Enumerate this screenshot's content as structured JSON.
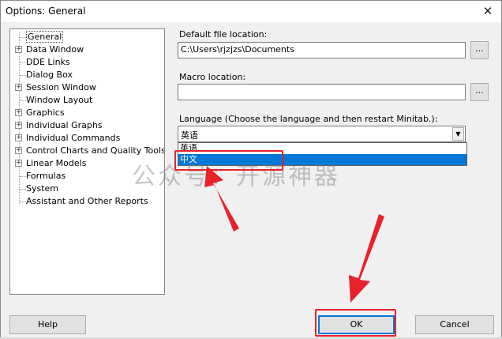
{
  "window": {
    "title": "Options: General",
    "close_glyph": "✕"
  },
  "tree": {
    "items": [
      {
        "label": "General",
        "expandable": false,
        "selected": true
      },
      {
        "label": "Data Window",
        "expandable": true
      },
      {
        "label": "DDE Links",
        "expandable": false
      },
      {
        "label": "Dialog Box",
        "expandable": false
      },
      {
        "label": "Session Window",
        "expandable": true
      },
      {
        "label": "Window Layout",
        "expandable": false
      },
      {
        "label": "Graphics",
        "expandable": true
      },
      {
        "label": "Individual Graphs",
        "expandable": true
      },
      {
        "label": "Individual Commands",
        "expandable": true
      },
      {
        "label": "Control Charts and Quality Tools",
        "expandable": true
      },
      {
        "label": "Linear Models",
        "expandable": true
      },
      {
        "label": "Formulas",
        "expandable": false
      },
      {
        "label": "System",
        "expandable": false
      },
      {
        "label": "Assistant and Other Reports",
        "expandable": false
      }
    ],
    "expand_glyph": "+"
  },
  "default_file": {
    "label": "Default file location:",
    "value": "C:\\Users\\rjzjzs\\Documents",
    "browse_label": "..."
  },
  "macro": {
    "label": "Macro location:",
    "value": "",
    "browse_label": "..."
  },
  "language": {
    "label": "Language (Choose the language and then restart Minitab.):",
    "value": "英语",
    "arrow_glyph": "▼",
    "options": [
      "英语",
      "中文"
    ],
    "highlighted_index": 1
  },
  "watermark": "公众号：开源神器",
  "buttons": {
    "help": "Help",
    "ok": "OK",
    "cancel": "Cancel"
  },
  "colors": {
    "annotation_red": "#e8222a",
    "selection_blue": "#0078d7"
  }
}
